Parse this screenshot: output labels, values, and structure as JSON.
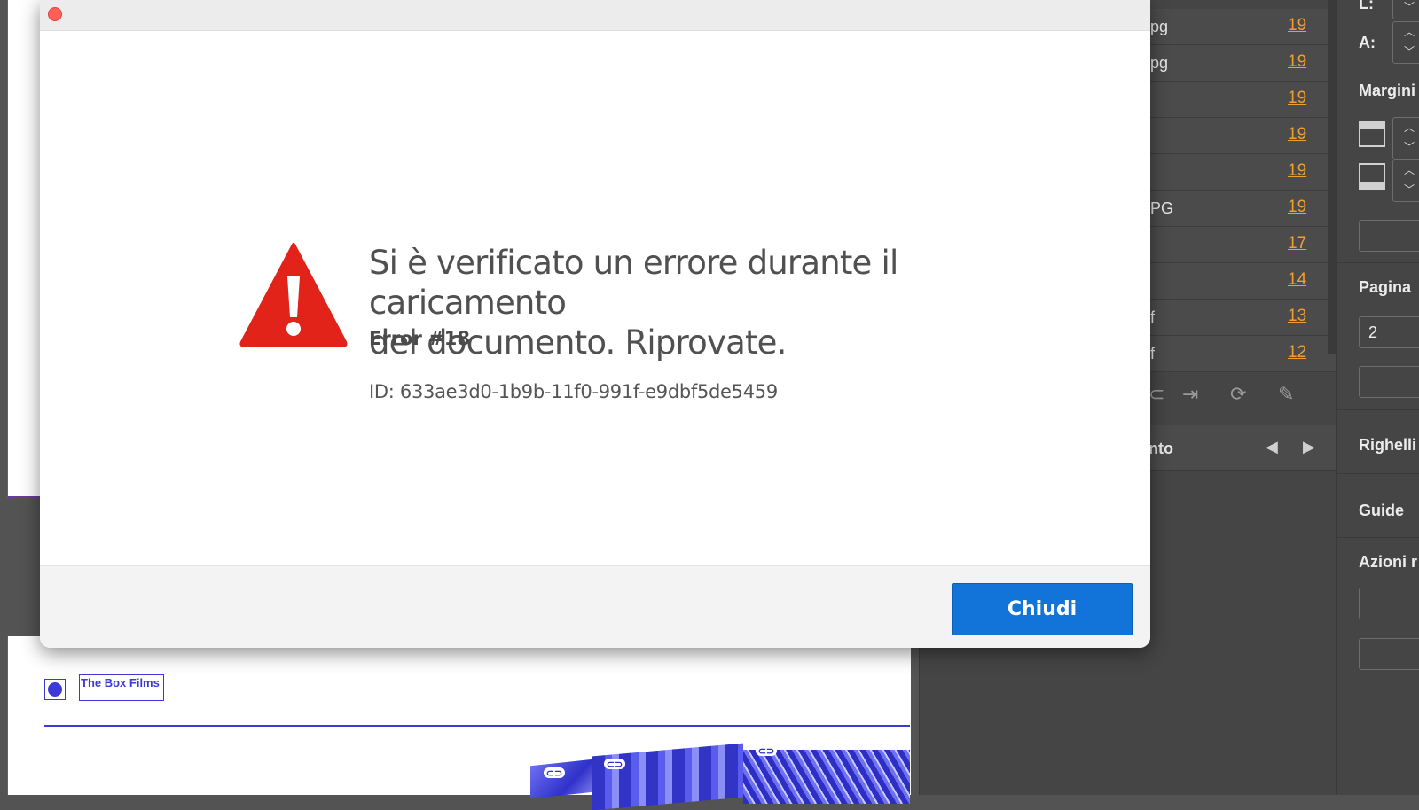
{
  "dialog": {
    "title_lines": [
      "Si è verificato un errore durante il caricamento",
      "del documento. Riprovate."
    ],
    "error_code": "Error #18",
    "error_id": "ID: 633ae3d0-1b9b-11f0-991f-e9dbf5de5459",
    "close_label": "Chiudi",
    "icon": "warning-icon"
  },
  "links_panel": {
    "rows": [
      {
        "name": "pg",
        "page": "19"
      },
      {
        "name": "pg",
        "page": "19"
      },
      {
        "name": "",
        "page": "19"
      },
      {
        "name": "",
        "page": "19"
      },
      {
        "name": "",
        "page": "19"
      },
      {
        "name": "PG",
        "page": "19"
      },
      {
        "name": "",
        "page": "17"
      },
      {
        "name": "",
        "page": "14"
      },
      {
        "name": "f",
        "page": "13"
      },
      {
        "name": "f",
        "page": "12"
      }
    ],
    "tools": [
      "relink-icon",
      "goto-link-icon",
      "update-link-icon",
      "edit-original-icon"
    ],
    "info_title": "nto"
  },
  "properties_panel": {
    "field_l_label": "L:",
    "field_a_label": "A:",
    "margins_label": "Margini",
    "page_label": "Pagina",
    "page_value": "2",
    "rulers_label": "Righelli",
    "guides_label": "Guide",
    "actions_label": "Azioni r"
  },
  "document": {
    "logo_text": "The Box Films"
  },
  "colors": {
    "accent": "#1273d8",
    "warning": "#e2231a",
    "link_page": "#f0a030",
    "doc_blue": "#3b3ad8"
  }
}
